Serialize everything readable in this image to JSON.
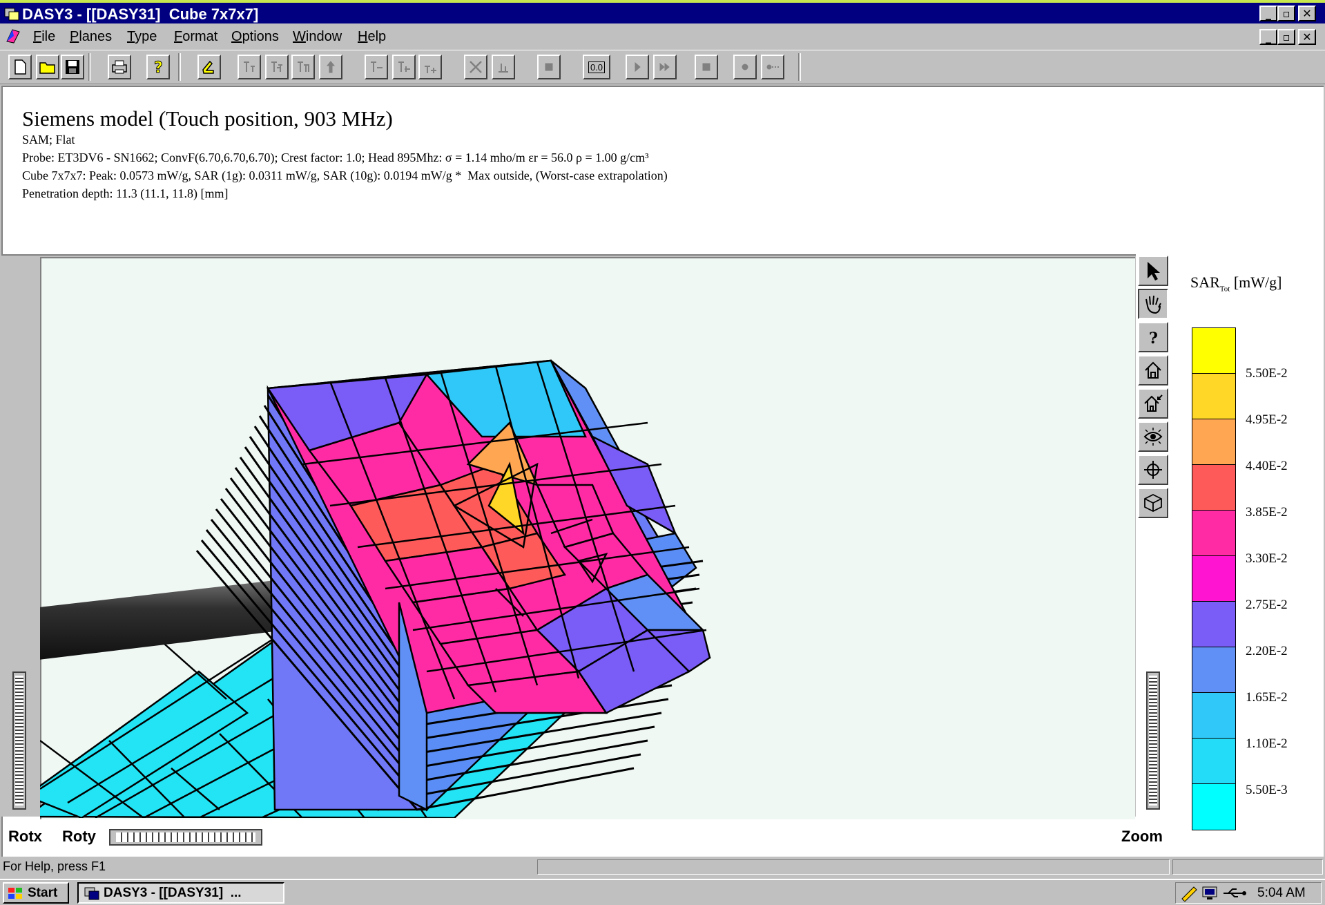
{
  "window": {
    "title": "DASY3 - [[DASY31]  Cube 7x7x7]"
  },
  "menu": {
    "items": [
      "File",
      "Planes",
      "Type",
      "Format",
      "Options",
      "Window",
      "Help"
    ]
  },
  "toolbar": {
    "value_display": "0.0"
  },
  "document": {
    "title": "Siemens model (Touch position, 903 MHz)",
    "lines": [
      "SAM; Flat",
      "Probe: ET3DV6 - SN1662; ConvF(6.70,6.70,6.70); Crest factor: 1.0; Head 895Mhz: σ = 1.14 mho/m εr = 56.0 ρ = 1.00 g/cm³",
      "Cube 7x7x7: Peak: 0.0573 mW/g, SAR (1g): 0.0311 mW/g, SAR (10g): 0.0194 mW/g *  Max outside, (Worst-case extrapolation)",
      "Penetration depth: 11.3 (11.1, 11.8) [mm]"
    ]
  },
  "view": {
    "rotx_label": "Rotx",
    "roty_label": "Roty",
    "zoom_label": "Zoom"
  },
  "legend": {
    "title_main": "SAR",
    "title_sub": "Tot",
    "title_unit": " [mW/g]",
    "labels": [
      "5.50E-2",
      "4.95E-2",
      "4.40E-2",
      "3.85E-2",
      "3.30E-2",
      "2.75E-2",
      "2.20E-2",
      "1.65E-2",
      "1.10E-2",
      "5.50E-3"
    ],
    "colors": [
      "#ffff00",
      "#ffd726",
      "#ffa652",
      "#ff5a5a",
      "#ff2ba4",
      "#ff14d2",
      "#7a5cf6",
      "#6090f6",
      "#30c8f8",
      "#22dcf8",
      "#00ffff"
    ]
  },
  "status": {
    "help_text": "For Help, press F1"
  },
  "taskbar": {
    "start_label": "Start",
    "task_label": "DASY3 - [[DASY31]  ...",
    "clock": "5:04 AM"
  }
}
